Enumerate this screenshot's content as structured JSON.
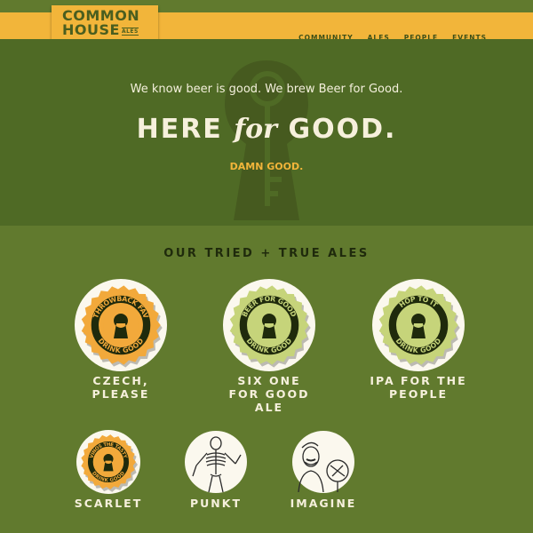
{
  "header": {
    "logo_line1": "COMMON",
    "logo_line2": "HOUSE",
    "logo_ales": "ALES",
    "nav": [
      "COMMUNITY",
      "ALES",
      "PEOPLE",
      "EVENTS"
    ]
  },
  "hero": {
    "tagline": "We know beer is good. We brew Beer for Good.",
    "headline_pre": "HERE",
    "headline_for": "for",
    "headline_post": "GOOD.",
    "sub": "DAMN GOOD."
  },
  "ales": {
    "title": "OUR TRIED + TRUE ALES",
    "items": [
      {
        "name": "CZECH,\nPLEASE",
        "cap_top": "THROWBACK FAV",
        "cap_bottom": "DRINK GOOD",
        "cap_color": "#f2a93b",
        "type": "cap"
      },
      {
        "name": "SIX ONE\nFOR GOOD\nALE",
        "cap_top": "BEER FOR GOOD",
        "cap_bottom": "DRINK GOOD",
        "cap_color": "#c6d47a",
        "type": "cap"
      },
      {
        "name": "IPA FOR THE\nPEOPLE",
        "cap_top": "HOP TO IT",
        "cap_bottom": "DRINK GOOD",
        "cap_color": "#c6d47a",
        "type": "cap"
      },
      {
        "name": "SCARLET",
        "cap_top": "VINOS THE TASTY",
        "cap_bottom": "DRINK GOOD",
        "cap_color": "#f2a93b",
        "type": "cap"
      },
      {
        "name": "PUNKT",
        "type": "skeleton"
      },
      {
        "name": "IMAGINE",
        "type": "portrait"
      }
    ]
  },
  "colors": {
    "header": "#f2b53a",
    "hero": "#4f6a25",
    "section": "#617a2e",
    "accent": "#f2b53a",
    "text_light": "#f6f0dc"
  },
  "icons": [
    "keyhole-icon",
    "key-icon",
    "bottle-cap-icon",
    "skeleton-illustration",
    "portrait-illustration"
  ]
}
